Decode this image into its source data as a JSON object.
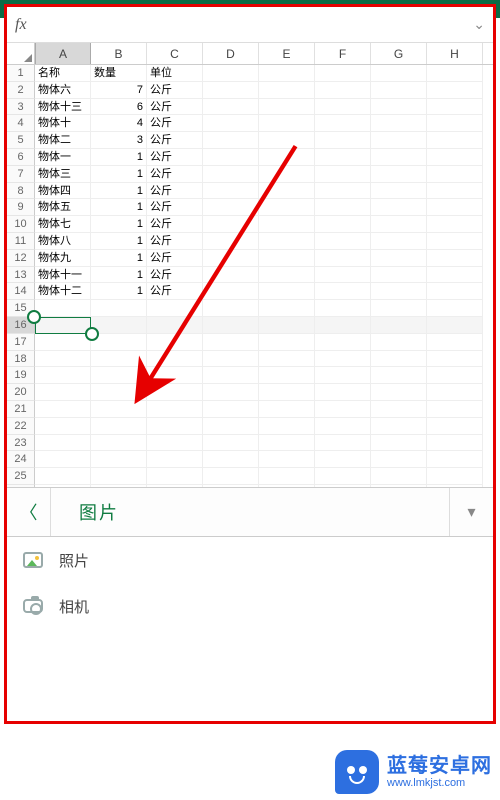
{
  "formula_bar": {
    "fx_label": "fx",
    "value": ""
  },
  "columns": [
    "A",
    "B",
    "C",
    "D",
    "E",
    "F",
    "G",
    "H"
  ],
  "selected_column_index": 0,
  "selected_row": 16,
  "visible_row_count": 26,
  "sheet": {
    "headers": {
      "A": "名称",
      "B": "数量",
      "C": "单位"
    },
    "rows": [
      {
        "A": "物体六",
        "B": 7,
        "C": "公斤"
      },
      {
        "A": "物体十三",
        "B": 6,
        "C": "公斤"
      },
      {
        "A": "物体十",
        "B": 4,
        "C": "公斤"
      },
      {
        "A": "物体二",
        "B": 3,
        "C": "公斤"
      },
      {
        "A": "物体一",
        "B": 1,
        "C": "公斤"
      },
      {
        "A": "物体三",
        "B": 1,
        "C": "公斤"
      },
      {
        "A": "物体四",
        "B": 1,
        "C": "公斤"
      },
      {
        "A": "物体五",
        "B": 1,
        "C": "公斤"
      },
      {
        "A": "物体七",
        "B": 1,
        "C": "公斤"
      },
      {
        "A": "物体八",
        "B": 1,
        "C": "公斤"
      },
      {
        "A": "物体九",
        "B": 1,
        "C": "公斤"
      },
      {
        "A": "物体十一",
        "B": 1,
        "C": "公斤"
      },
      {
        "A": "物体十二",
        "B": 1,
        "C": "公斤"
      }
    ]
  },
  "ribbon": {
    "back_icon": "chevron-left",
    "title": "图片",
    "more_icon": "chevron-down"
  },
  "menu": {
    "items": [
      {
        "icon": "photo-icon",
        "label": "照片"
      },
      {
        "icon": "camera-icon",
        "label": "相机"
      }
    ]
  },
  "watermark": {
    "brand": "蓝莓安卓网",
    "url": "www.lmkjst.com"
  },
  "annotation": {
    "arrow_color": "#e60000",
    "points_from": "upper-right-grid",
    "points_to": "camera-menu-item"
  }
}
